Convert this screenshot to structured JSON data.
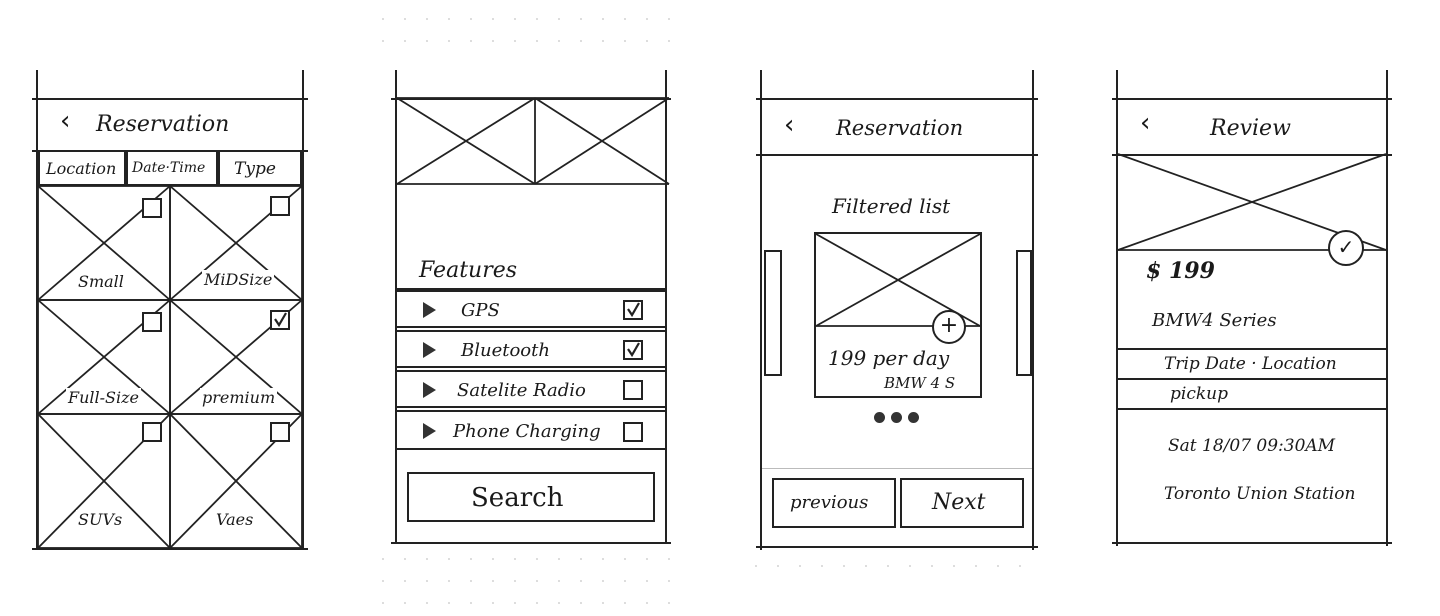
{
  "screen1": {
    "title": "Reservation",
    "back_icon": "chevron-left-icon",
    "tabs": [
      "Location",
      "Date·Time",
      "Type"
    ],
    "categories": [
      {
        "label": "Small",
        "checked": false
      },
      {
        "label": "MiDSize",
        "checked": false
      },
      {
        "label": "Full-Size",
        "checked": false
      },
      {
        "label": "premium",
        "checked": true
      },
      {
        "label": "SUVs",
        "checked": false
      },
      {
        "label": "Vaes",
        "checked": false
      }
    ]
  },
  "screen2": {
    "features_title": "Features",
    "features": [
      {
        "label": "GPS",
        "checked": true
      },
      {
        "label": "Bluetooth",
        "checked": true
      },
      {
        "label": "Satelite Radio",
        "checked": false
      },
      {
        "label": "Phone Charging",
        "checked": false
      }
    ],
    "search_label": "Search"
  },
  "screen3": {
    "title": "Reservation",
    "list_title": "Filtered list",
    "price_line": "199 per day",
    "model_line": "BMW 4 S",
    "add_icon": "plus-circle-icon",
    "previous_label": "previous",
    "next_label": "Next"
  },
  "screen4": {
    "title": "Review",
    "price": "$ 199",
    "model": "BMW4 Series",
    "section_label": "Trip Date · Location",
    "pickup_label": "pickup",
    "datetime": "Sat 18/07 09:30AM",
    "location": "Toronto Union Station",
    "check_icon": "check-circle-icon"
  }
}
